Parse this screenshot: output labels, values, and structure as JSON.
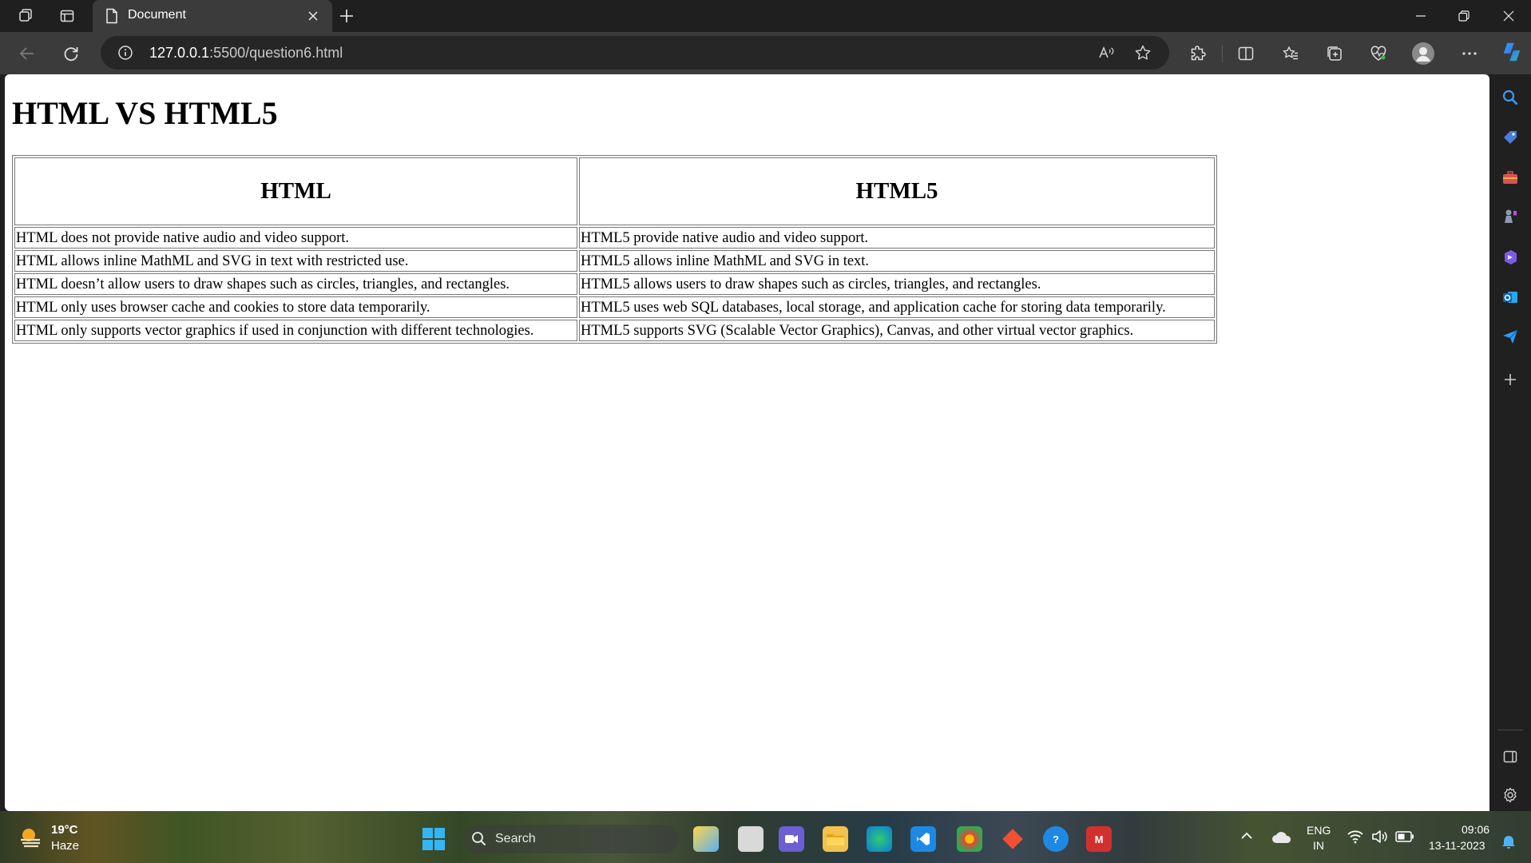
{
  "browser": {
    "tab_title": "Document",
    "url_host": "127.0.0.1",
    "url_rest": ":5500/question6.html"
  },
  "page": {
    "heading": "HTML VS HTML5",
    "table": {
      "headers": [
        "HTML",
        "HTML5"
      ],
      "rows": [
        [
          "HTML does not provide native audio and video support.",
          "HTML5 provide native audio and video support."
        ],
        [
          "HTML allows inline MathML and SVG in text with restricted use.",
          "HTML5 allows inline MathML and SVG in text."
        ],
        [
          "HTML doesn’t allow users to draw shapes such as circles, triangles, and rectangles.",
          "HTML5 allows users to draw shapes such as circles, triangles, and rectangles."
        ],
        [
          "HTML only uses browser cache and cookies to store data temporarily.",
          "HTML5 uses web SQL databases, local storage, and application cache for storing data temporarily."
        ],
        [
          "HTML only supports vector graphics if used in conjunction with different technologies.",
          "HTML5 supports SVG (Scalable Vector Graphics), Canvas, and other virtual vector graphics."
        ]
      ]
    }
  },
  "taskbar": {
    "weather_temp": "19°C",
    "weather_condition": "Haze",
    "search_label": "Search",
    "language": "ENG",
    "region": "IN",
    "time": "09:06",
    "date": "13-11-2023"
  }
}
